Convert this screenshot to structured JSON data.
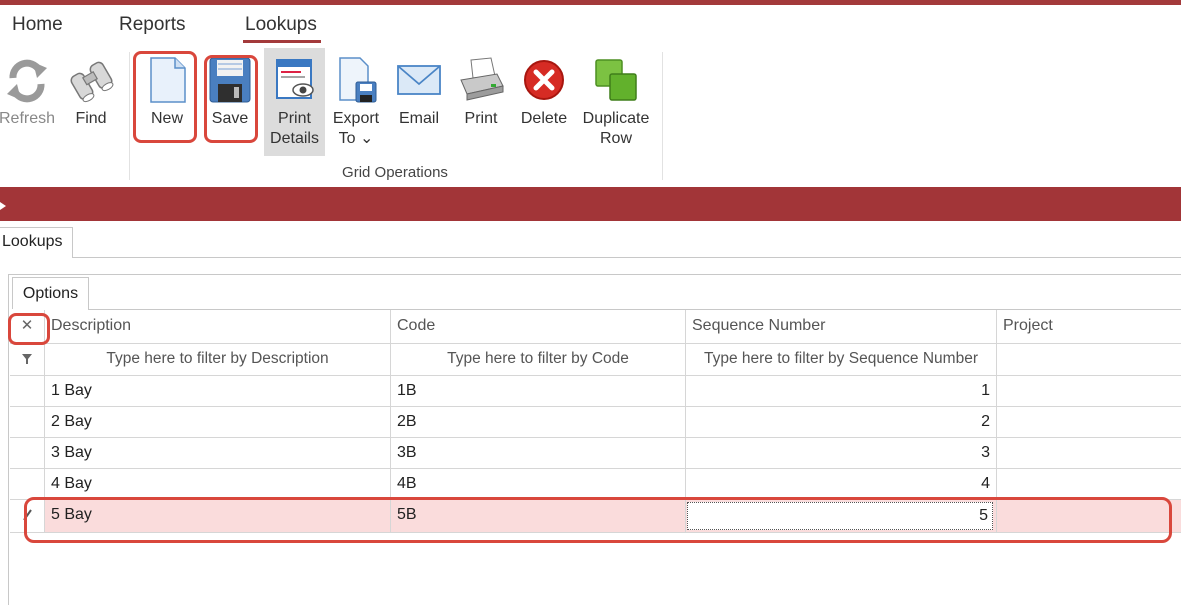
{
  "app": {
    "tabs": [
      {
        "label": "Home"
      },
      {
        "label": "Reports"
      },
      {
        "label": "Lookups"
      }
    ]
  },
  "ribbon": {
    "buttons": [
      {
        "label": "Refresh",
        "icon": "refresh-icon"
      },
      {
        "label": "Find",
        "icon": "binoculars-icon"
      },
      {
        "label": "New",
        "icon": "new-document-icon"
      },
      {
        "label": "Save",
        "icon": "floppy-disk-icon"
      },
      {
        "label": "Print\nDetails",
        "icon": "print-preview-icon"
      },
      {
        "label": "Export\nTo ⌄",
        "icon": "export-icon"
      },
      {
        "label": "Email",
        "icon": "envelope-icon"
      },
      {
        "label": "Print",
        "icon": "printer-icon"
      },
      {
        "label": "Delete",
        "icon": "delete-icon"
      },
      {
        "label": "Duplicate\nRow",
        "icon": "duplicate-icon"
      }
    ],
    "group_label": "Grid Operations"
  },
  "document_tab": "Lookups",
  "options_tab": "Options",
  "grid": {
    "columns": [
      "Description",
      "Code",
      "Sequence Number",
      "Project"
    ],
    "filters": [
      "Type here to filter by Description",
      "Type here to filter by Code",
      "Type here to filter by Sequence Number",
      ""
    ],
    "rows": [
      {
        "description": "1 Bay",
        "code": "1B",
        "sequence": "1"
      },
      {
        "description": "2 Bay",
        "code": "2B",
        "sequence": "2"
      },
      {
        "description": "3 Bay",
        "code": "3B",
        "sequence": "3"
      },
      {
        "description": "4 Bay",
        "code": "4B",
        "sequence": "4"
      }
    ],
    "new_row": {
      "description": "5 Bay",
      "code": "5B",
      "sequence": "5"
    }
  },
  "colors": {
    "accent": "#a33a3b",
    "highlight": "#d9473c",
    "new_row_bg": "#fadcdc"
  }
}
